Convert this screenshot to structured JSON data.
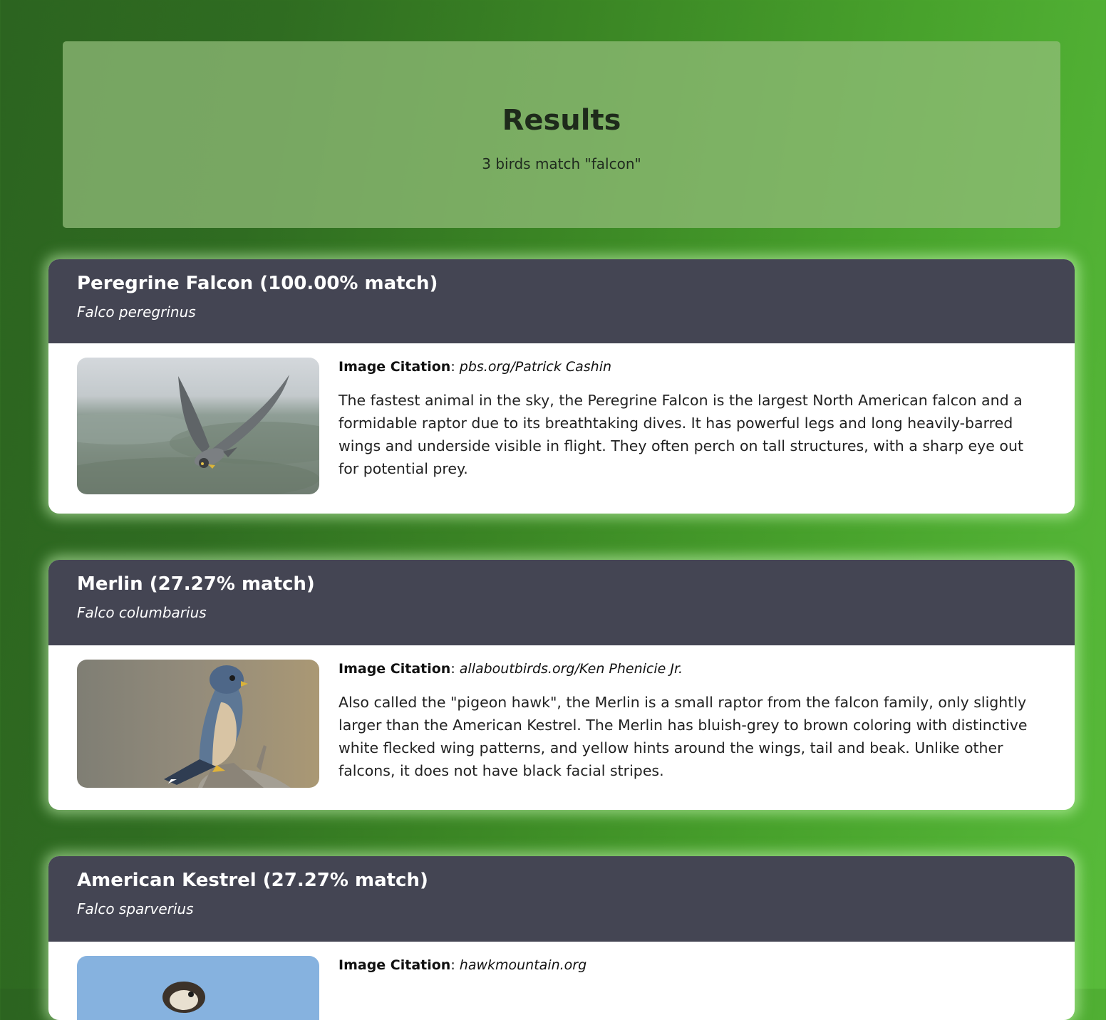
{
  "header": {
    "title": "Results",
    "subtitle": "3 birds match \"falcon\""
  },
  "results": [
    {
      "name": "Peregrine Falcon (100.00% match)",
      "scientific_name": "Falco peregrinus",
      "citation_label": "Image Citation",
      "citation_separator": ":",
      "citation_value": "pbs.org/Patrick Cashin",
      "description": "The fastest animal in the sky, the Peregrine Falcon is the largest North American falcon and a formidable raptor due to its breathtaking dives. It has powerful legs and long heavily-barred wings and underside visible in flight. They often perch on tall structures, with a sharp eye out for potential prey."
    },
    {
      "name": "Merlin (27.27% match)",
      "scientific_name": "Falco columbarius",
      "citation_label": "Image Citation",
      "citation_separator": ":",
      "citation_value": "allaboutbirds.org/Ken Phenicie Jr.",
      "description": "Also called the \"pigeon hawk\", the Merlin is a small raptor from the falcon family, only slightly larger than the American Kestrel. The Merlin has bluish-grey to brown coloring with distinctive white flecked wing patterns, and yellow hints around the wings, tail and beak. Unlike other falcons, it does not have black facial stripes."
    },
    {
      "name": "American Kestrel (27.27% match)",
      "scientific_name": "Falco sparverius",
      "citation_label": "Image Citation",
      "citation_separator": ":",
      "citation_value": "hawkmountain.org",
      "description": ""
    }
  ],
  "colors": {
    "card_header": "#444553",
    "card_body": "#ffffff",
    "hero_panel": "#7ca85a"
  }
}
